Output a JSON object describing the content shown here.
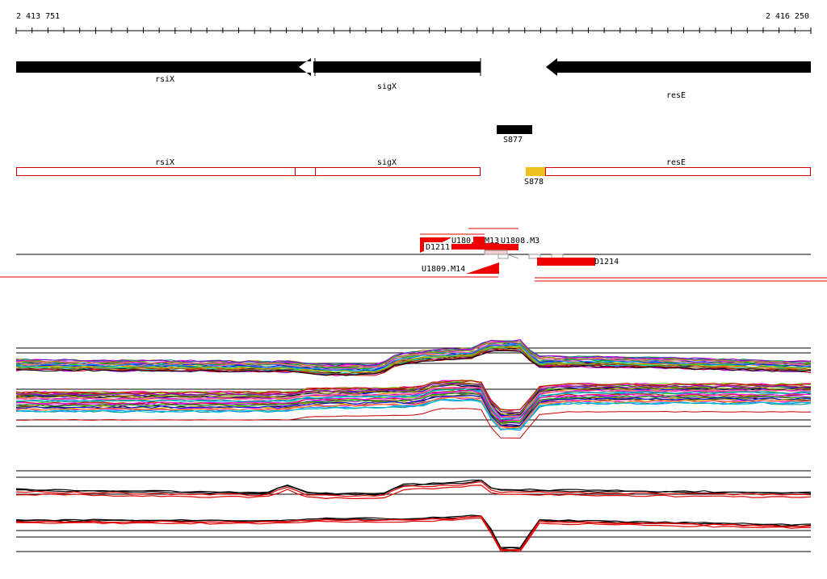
{
  "ruler": {
    "start_label": "2 413 751",
    "end_label": "2 416 250"
  },
  "genes": [
    {
      "name": "rsiX",
      "strand": "-"
    },
    {
      "name": "sigX",
      "strand": "-"
    },
    {
      "name": "resE",
      "strand": "-"
    }
  ],
  "transcribed_units": [
    {
      "label": "S877"
    },
    {
      "label": "S878"
    }
  ],
  "cds_track_labels": [
    "rsiX",
    "sigX",
    "resE"
  ],
  "probe_labels": [
    {
      "label": "D1211"
    },
    {
      "label": "U180"
    },
    {
      "label": "M13"
    },
    {
      "label": "U1808.M3"
    },
    {
      "label": "U1809.M14"
    },
    {
      "label": "D1214"
    }
  ],
  "colors": {
    "gene": "#000000",
    "outline": "#cc0000",
    "probe": "#ee0000",
    "s878": "#f0c020",
    "profile_upper": "#000000",
    "profile_lower": "#dd0000"
  }
}
